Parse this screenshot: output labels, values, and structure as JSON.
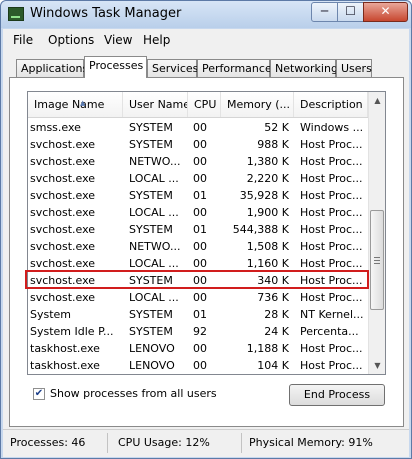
{
  "window": {
    "title": "Windows Task Manager"
  },
  "title_buttons": {
    "minimize": "─",
    "maximize": "☐",
    "close": "✕"
  },
  "menu": [
    "File",
    "Options",
    "View",
    "Help"
  ],
  "tabs": [
    "Applications",
    "Processes",
    "Services",
    "Performance",
    "Networking",
    "Users"
  ],
  "active_tab": "Processes",
  "columns": [
    "Image Name",
    "User Name",
    "CPU",
    "Memory (...",
    "Description"
  ],
  "rows": [
    [
      "smss.exe",
      "SYSTEM",
      "00",
      "52 K",
      "Windows ..."
    ],
    [
      "svchost.exe",
      "SYSTEM",
      "00",
      "988 K",
      "Host Proc..."
    ],
    [
      "svchost.exe",
      "NETWO...",
      "00",
      "1,380 K",
      "Host Proc..."
    ],
    [
      "svchost.exe",
      "LOCAL ...",
      "00",
      "2,220 K",
      "Host Proc..."
    ],
    [
      "svchost.exe",
      "SYSTEM",
      "01",
      "35,928 K",
      "Host Proc..."
    ],
    [
      "svchost.exe",
      "LOCAL ...",
      "00",
      "1,900 K",
      "Host Proc..."
    ],
    [
      "svchost.exe",
      "SYSTEM",
      "01",
      "544,388 K",
      "Host Proc..."
    ],
    [
      "svchost.exe",
      "NETWO...",
      "00",
      "1,508 K",
      "Host Proc..."
    ],
    [
      "svchost.exe",
      "LOCAL ...",
      "00",
      "1,160 K",
      "Host Proc..."
    ],
    [
      "svchost.exe",
      "SYSTEM",
      "00",
      "340 K",
      "Host Proc..."
    ],
    [
      "svchost.exe",
      "LOCAL ...",
      "00",
      "736 K",
      "Host Proc..."
    ],
    [
      "System",
      "SYSTEM",
      "01",
      "28 K",
      "NT Kernel..."
    ],
    [
      "System Idle P...",
      "SYSTEM",
      "92",
      "24 K",
      "Percenta..."
    ],
    [
      "taskhost.exe",
      "LENOVO",
      "00",
      "1,188 K",
      "Host Proc..."
    ],
    [
      "taskhost.exe",
      "LENOVO",
      "00",
      "104 K",
      "Host Proc..."
    ]
  ],
  "highlighted_row": 6,
  "show_all_label": "Show processes from all users",
  "show_all_checked": true,
  "end_process_label": "End Process",
  "status": {
    "processes": "Processes: 46",
    "cpu": "CPU Usage: 12%",
    "memory": "Physical Memory: 91%"
  },
  "colors": {
    "highlight_border": "#d11d1d",
    "title_gradient": "#c7d8ee",
    "close_button": "#c7472f"
  },
  "icons": {
    "app": "task-manager-icon",
    "sort": "sort-ascending-icon",
    "check": "checkmark-icon"
  }
}
